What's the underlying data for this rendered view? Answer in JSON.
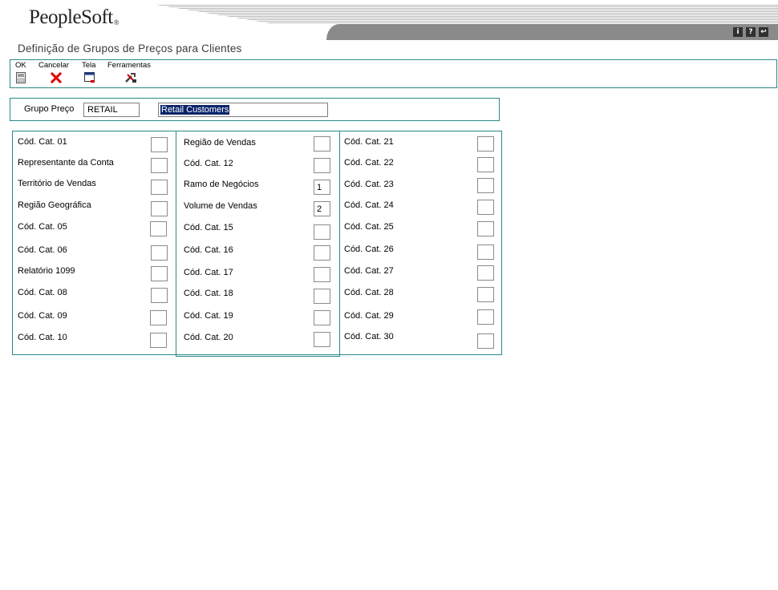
{
  "brand": {
    "name": "PeopleSoft",
    "mark": "®"
  },
  "header_icons": [
    {
      "name": "info-icon",
      "glyph": "i"
    },
    {
      "name": "help-icon",
      "glyph": "?"
    },
    {
      "name": "exit-icon",
      "glyph": "↩"
    }
  ],
  "page_title": "Definição de Grupos de Preços para Clientes",
  "toolbar": {
    "ok_label": "OK",
    "cancel_label": "Cancelar",
    "screen_label": "Tela",
    "tools_label": "Ferramentas"
  },
  "header": {
    "group_label": "Grupo Preço",
    "group_code": "RETAIL",
    "group_description": "Retail Customers"
  },
  "categories": {
    "col1": [
      {
        "label": "Cód. Cat. 01",
        "value": ""
      },
      {
        "label": "Representante da Conta",
        "value": ""
      },
      {
        "label": "Território de Vendas",
        "value": ""
      },
      {
        "label": "Região Geográfica",
        "value": ""
      },
      {
        "label": "Cód. Cat. 05",
        "value": ""
      },
      {
        "label": "Cód. Cat. 06",
        "value": ""
      },
      {
        "label": "Relatório 1099",
        "value": ""
      },
      {
        "label": "Cód. Cat. 08",
        "value": ""
      },
      {
        "label": "Cód. Cat. 09",
        "value": ""
      },
      {
        "label": "Cód. Cat. 10",
        "value": ""
      }
    ],
    "col2": [
      {
        "label": "Região de Vendas",
        "value": ""
      },
      {
        "label": "Cód. Cat. 12",
        "value": ""
      },
      {
        "label": "Ramo de Negócios",
        "value": "1"
      },
      {
        "label": "Volume de Vendas",
        "value": "2"
      },
      {
        "label": "Cód. Cat. 15",
        "value": ""
      },
      {
        "label": "Cód. Cat. 16",
        "value": ""
      },
      {
        "label": "Cód. Cat. 17",
        "value": ""
      },
      {
        "label": "Cód. Cat. 18",
        "value": ""
      },
      {
        "label": "Cód. Cat. 19",
        "value": ""
      },
      {
        "label": "Cód. Cat. 20",
        "value": ""
      }
    ],
    "col3": [
      {
        "label": "Cód. Cat. 21",
        "value": ""
      },
      {
        "label": "Cód. Cat. 22",
        "value": ""
      },
      {
        "label": "Cód. Cat. 23",
        "value": ""
      },
      {
        "label": "Cód. Cat. 24",
        "value": ""
      },
      {
        "label": "Cód. Cat. 25",
        "value": ""
      },
      {
        "label": "Cód. Cat. 26",
        "value": ""
      },
      {
        "label": "Cód. Cat. 27",
        "value": ""
      },
      {
        "label": "Cód. Cat. 28",
        "value": ""
      },
      {
        "label": "Cód. Cat. 29",
        "value": ""
      },
      {
        "label": "Cód. Cat. 30",
        "value": ""
      }
    ]
  }
}
